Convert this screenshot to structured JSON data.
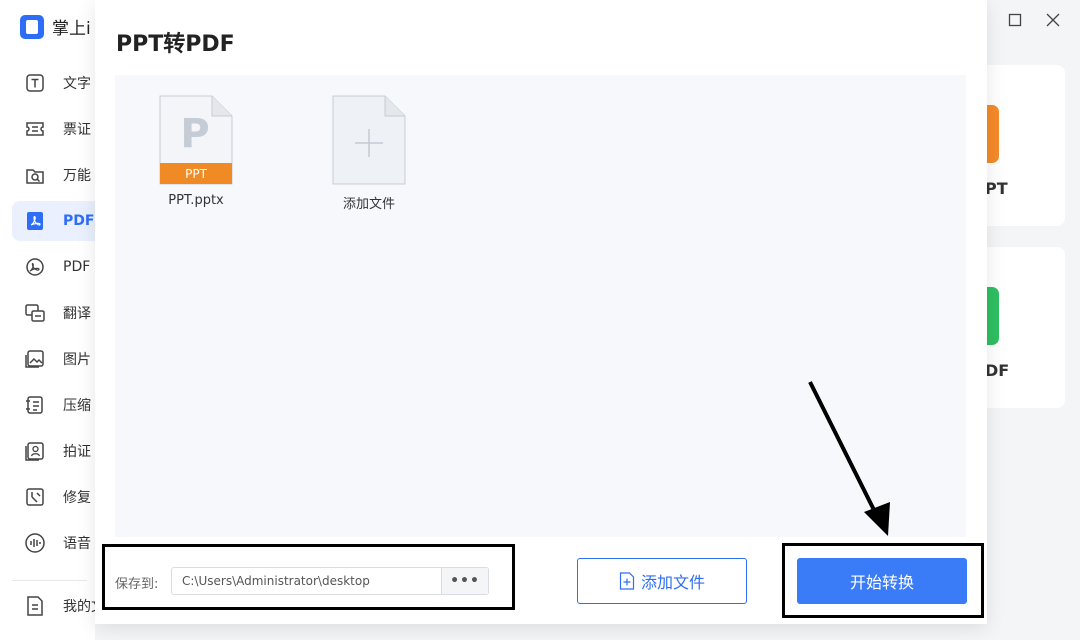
{
  "app": {
    "title": "掌上i"
  },
  "sidebar": {
    "items": [
      {
        "label": "文字",
        "icon": "text-icon"
      },
      {
        "label": "票证",
        "icon": "ticket-icon"
      },
      {
        "label": "万能",
        "icon": "scan-icon"
      },
      {
        "label": "PDF",
        "icon": "pdf-icon",
        "active": true
      },
      {
        "label": "PDF",
        "icon": "pdf-convert-icon"
      },
      {
        "label": "翻译",
        "icon": "translate-icon"
      },
      {
        "label": "图片",
        "icon": "image-icon"
      },
      {
        "label": "压缩",
        "icon": "compress-icon"
      },
      {
        "label": "拍证",
        "icon": "id-photo-icon"
      },
      {
        "label": "修复",
        "icon": "repair-icon"
      },
      {
        "label": "语音",
        "icon": "voice-icon"
      }
    ],
    "footer_label": "我的文"
  },
  "background_cards": [
    {
      "label": "PT",
      "icon_color": "#f58a2a"
    },
    {
      "label": "DF",
      "icon_color": "#2fbf62"
    }
  ],
  "dialog": {
    "title": "PPT转PDF",
    "files": [
      {
        "name": "PPT.pptx",
        "letter": "P",
        "type_label": "PPT",
        "accent": "#f08a24"
      }
    ],
    "add_placeholder_label": "添加文件",
    "save_to_label": "保存到:",
    "save_path": "C:\\Users\\Administrator\\desktop",
    "browse_label": "•••",
    "add_file_button": "添加文件",
    "start_button": "开始转换"
  },
  "colors": {
    "accent": "#2e6ef6",
    "primary_button": "#3a7bf7"
  }
}
